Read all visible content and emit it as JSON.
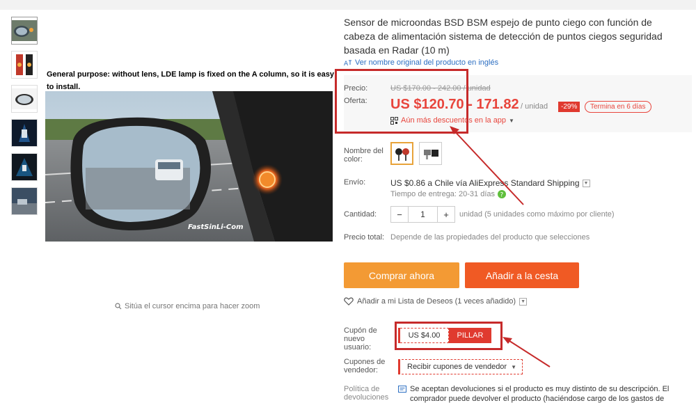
{
  "gallery": {
    "thumbnails": [
      "thumb-1",
      "thumb-2",
      "thumb-3",
      "thumb-4",
      "thumb-5",
      "thumb-6"
    ],
    "caption": "General purpose: without lens, LDE lamp is fixed on the A column, so it is easy to install.",
    "watermark": "FastSinLi-Com",
    "zoom_hint": "Sitúa el cursor encima para hacer zoom"
  },
  "product": {
    "title": "Sensor de microondas BSD BSM espejo de punto ciego con función de cabeza de alimentación sistema de detección de puntos ciegos seguridad basada en Radar (10 m)",
    "original_name_link": "Ver nombre original del producto en inglés"
  },
  "price": {
    "price_label": "Precio:",
    "offer_label": "Oferta:",
    "old_price": "US $170.00 - 242.00 / unidad",
    "new_price": "US $120.70 - 171.82",
    "per_unit": "/ unidad",
    "discount": "-29%",
    "ends": "Termina en 6 días",
    "app_discount": "Aún más descuentos en la app"
  },
  "options": {
    "color_label": "Nombre del color:",
    "shipping_label": "Envío:",
    "shipping_main": "US $0.86 a Chile vía AliExpress Standard Shipping",
    "delivery_time": "Tiempo de entrega: 20-31 días",
    "quantity_label": "Cantidad:",
    "quantity_value": "1",
    "quantity_note": "unidad (5 unidades como máximo por cliente)",
    "total_label": "Precio total:",
    "total_text": "Depende de las propiedades del producto que selecciones"
  },
  "actions": {
    "buy_now": "Comprar ahora",
    "add_to_cart": "Añadir a la cesta",
    "wishlist": "Añadir a mi Lista de Deseos (1 veces añadido)"
  },
  "coupons": {
    "new_user_label": "Cupón de nuevo usuario:",
    "new_user_amount": "US $4.00",
    "grab": "PILLAR",
    "vendor_label": "Cupones de vendedor:",
    "vendor_button": "Recibir cupones de vendedor",
    "policy_label": "Política de devoluciones",
    "policy_text": "Se aceptan devoluciones si el producto es muy distinto de su descripción. El comprador puede devolver el producto (haciéndose cargo de los gastos de"
  },
  "colors": {
    "accent_red": "#e8453c",
    "buy_orange": "#f39a34",
    "cart_orange": "#f05a24",
    "annotation_red": "#c62a2a"
  }
}
